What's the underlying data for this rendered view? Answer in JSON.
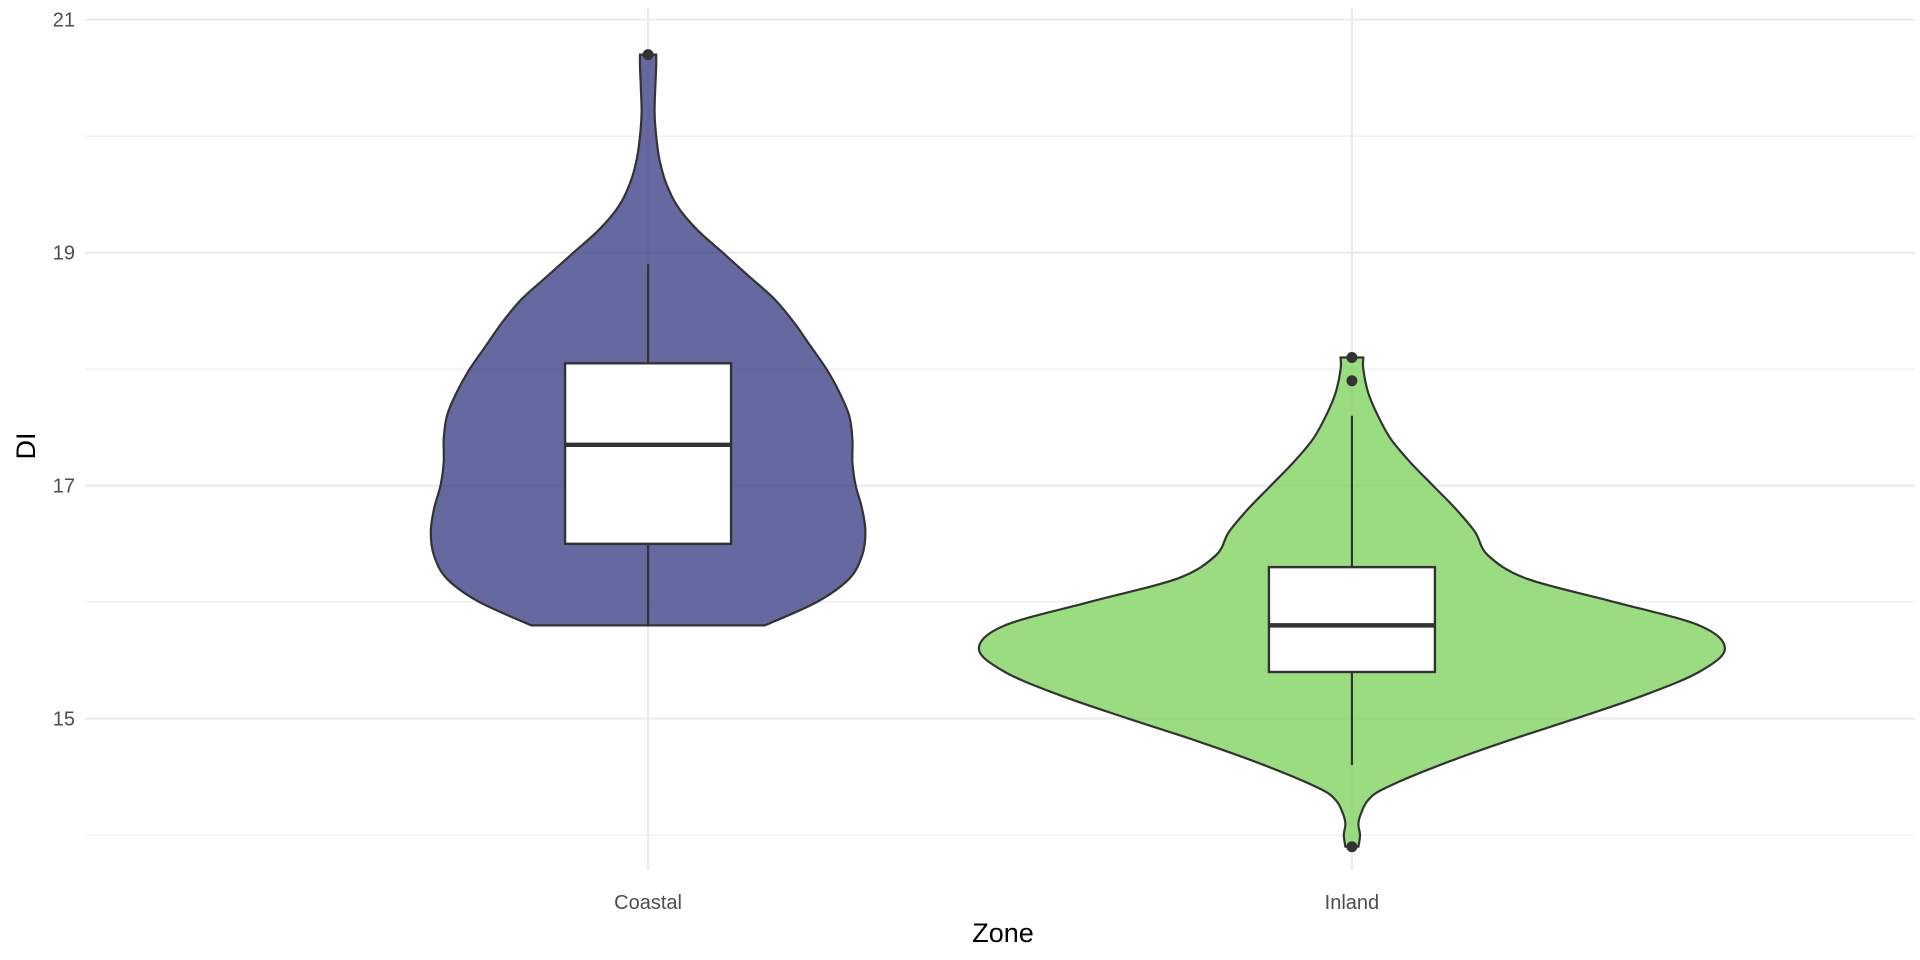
{
  "chart_data": {
    "type": "violin",
    "title": "",
    "xlabel": "Zone",
    "ylabel": "DI",
    "categories": [
      "Coastal",
      "Inland"
    ],
    "ylim": [
      13.7,
      21.1
    ],
    "yticks": [
      15,
      17,
      19,
      21
    ],
    "ytick_labels": [
      "15",
      "17",
      "19",
      "21"
    ],
    "grid": true,
    "legend": "none",
    "series": [
      {
        "category": "Coastal",
        "color": "#3b3f85",
        "box": {
          "min": 15.8,
          "q1": 16.5,
          "median": 17.35,
          "q3": 18.05,
          "max": 18.9
        },
        "outliers": [
          20.7
        ],
        "density": [
          [
            15.8,
            0.36
          ],
          [
            16.0,
            0.52
          ],
          [
            16.2,
            0.62
          ],
          [
            16.4,
            0.66
          ],
          [
            16.6,
            0.67
          ],
          [
            16.8,
            0.66
          ],
          [
            17.0,
            0.64
          ],
          [
            17.2,
            0.63
          ],
          [
            17.4,
            0.63
          ],
          [
            17.6,
            0.62
          ],
          [
            17.8,
            0.59
          ],
          [
            18.0,
            0.55
          ],
          [
            18.2,
            0.5
          ],
          [
            18.4,
            0.45
          ],
          [
            18.6,
            0.39
          ],
          [
            18.8,
            0.31
          ],
          [
            19.0,
            0.23
          ],
          [
            19.2,
            0.15
          ],
          [
            19.4,
            0.09
          ],
          [
            19.6,
            0.055
          ],
          [
            19.8,
            0.035
          ],
          [
            20.0,
            0.025
          ],
          [
            20.2,
            0.02
          ],
          [
            20.4,
            0.022
          ],
          [
            20.6,
            0.025
          ],
          [
            20.7,
            0.025
          ]
        ]
      },
      {
        "category": "Inland",
        "color": "#7cd45c",
        "box": {
          "min": 14.6,
          "q1": 15.4,
          "median": 15.8,
          "q3": 16.3,
          "max": 17.6
        },
        "outliers": [
          13.9,
          17.9,
          18.1
        ],
        "density": [
          [
            13.9,
            0.02
          ],
          [
            14.0,
            0.025
          ],
          [
            14.1,
            0.02
          ],
          [
            14.2,
            0.03
          ],
          [
            14.3,
            0.05
          ],
          [
            14.4,
            0.1
          ],
          [
            14.6,
            0.27
          ],
          [
            14.8,
            0.47
          ],
          [
            15.0,
            0.69
          ],
          [
            15.2,
            0.9
          ],
          [
            15.4,
            1.07
          ],
          [
            15.6,
            1.15
          ],
          [
            15.8,
            1.07
          ],
          [
            16.0,
            0.81
          ],
          [
            16.2,
            0.54
          ],
          [
            16.4,
            0.42
          ],
          [
            16.6,
            0.38
          ],
          [
            16.8,
            0.32
          ],
          [
            17.0,
            0.25
          ],
          [
            17.2,
            0.18
          ],
          [
            17.4,
            0.12
          ],
          [
            17.6,
            0.08
          ],
          [
            17.8,
            0.05
          ],
          [
            18.0,
            0.035
          ],
          [
            18.1,
            0.035
          ]
        ]
      }
    ]
  }
}
